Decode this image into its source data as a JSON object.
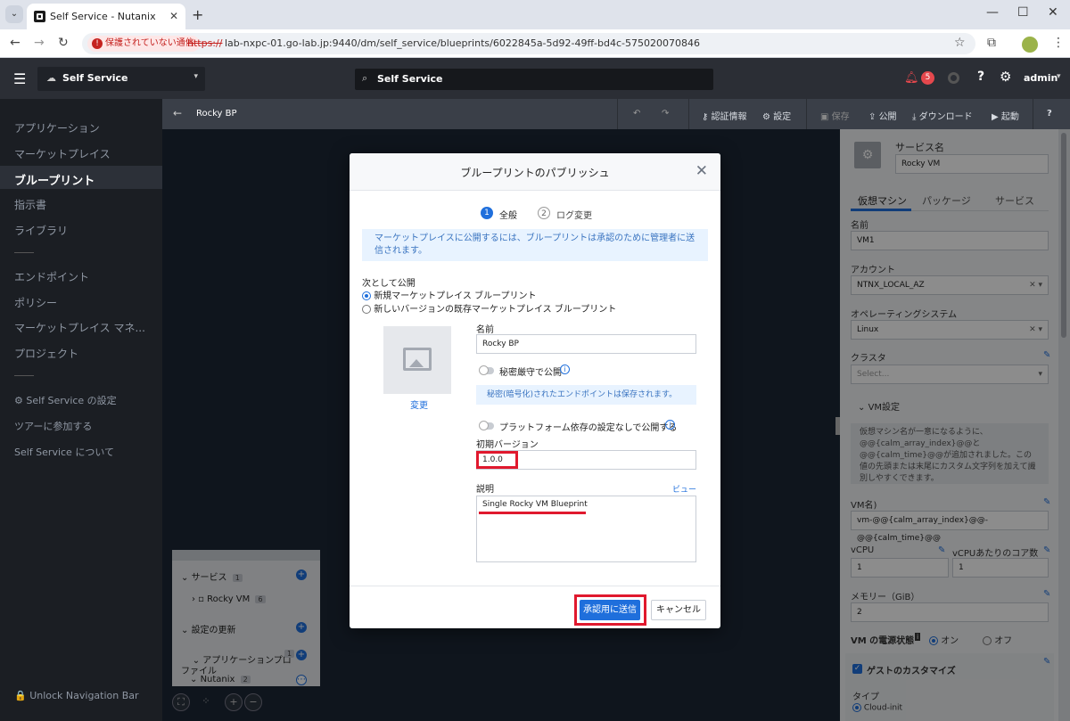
{
  "browser": {
    "tab_title": "Self Service - Nutanix",
    "new_tab": "+",
    "tab_close": "✕",
    "win_min": "—",
    "win_max": "☐",
    "win_close": "✕",
    "back": "←",
    "forward": "→",
    "reload": "↻",
    "not_secure": "保護されていない通信",
    "url_protocol": "https://",
    "url_rest": "lab-nxpc-01.go-lab.jp:9440/dm/self_service/blueprints/6022845a-5d92-49ff-bd4c-575020070846",
    "star": "☆",
    "menu": "⋮"
  },
  "header": {
    "app_name": "Self Service",
    "search_placeholder": "Self Service",
    "notification_count": "5",
    "help": "?",
    "user": "admin"
  },
  "sidebar": {
    "items": [
      {
        "label": "アプリケーション"
      },
      {
        "label": "マーケットプレイス"
      },
      {
        "label": "ブループリント"
      },
      {
        "label": "指示書"
      },
      {
        "label": "ライブラリ"
      },
      {
        "label": "エンドポイント"
      },
      {
        "label": "ポリシー"
      },
      {
        "label": "マーケットプレイス マネ..."
      },
      {
        "label": "プロジェクト"
      },
      {
        "label": "⚙ Self Service の設定"
      },
      {
        "label": "ツアーに参加する"
      },
      {
        "label": "Self Service について"
      }
    ],
    "unlock": "🔒 Unlock Navigation Bar"
  },
  "toolbar": {
    "blueprint_name": "Rocky BP",
    "credentials": "認証情報",
    "settings": "設定",
    "save": "保存",
    "publish": "公開",
    "download": "ダウンロード",
    "launch": "起動",
    "help": "?"
  },
  "mini_panel": {
    "services": "サービス",
    "services_count": "1",
    "rocky_vm": "Rocky VM",
    "rocky_vm_count": "6",
    "update_config": "設定の更新",
    "app_profile": "アプリケーションプロ\nファイル",
    "app_profile_count": "1",
    "nutanix": "Nutanix",
    "nutanix_count": "2"
  },
  "right_panel": {
    "service_name_label": "サービス名",
    "service_name": "Rocky VM",
    "tabs": [
      "仮想マシン",
      "パッケージ",
      "サービス"
    ],
    "name_label": "名前",
    "name_value": "VM1",
    "account_label": "アカウント",
    "account_value": "NTNX_LOCAL_AZ",
    "os_label": "オペレーティングシステム",
    "os_value": "Linux",
    "cluster_label": "クラスタ",
    "cluster_placeholder": "Select...",
    "vm_settings": "VM設定",
    "vm_note": "仮想マシン名が一意になるように、@@{calm_array_index}@@と@@{calm_time}@@が追加されました。この値の先頭または末尾にカスタム文字列を加えて識別しやすくできます。",
    "vm_name_label": "VM名)",
    "vm_name_value": "vm-@@{calm_array_index}@@-@@{calm_time}@@",
    "vcpu_label": "vCPU",
    "vcpu_value": "1",
    "cores_label": "vCPUあたりのコア数",
    "cores_value": "1",
    "memory_label": "メモリー（GiB）",
    "memory_value": "2",
    "power_label": "VM の電源状態",
    "power_on": "オン",
    "power_off": "オフ",
    "guest_custom": "ゲストのカスタマイズ",
    "type_label": "タイプ",
    "cloud_init": "Cloud-init"
  },
  "modal": {
    "title": "ブループリントのパブリッシュ",
    "step1_num": "1",
    "step1": "全般",
    "step2_num": "2",
    "step2": "ログ変更",
    "info": "マーケットプレイスに公開するには、ブループリントは承認のために管理者に送信されます。",
    "publish_as": "次として公開",
    "option_new": "新規マーケットプレイス ブループリント",
    "option_existing": "新しいバージョンの既存マーケットプレイス ブループリント",
    "change_image": "変更",
    "name_label": "名前",
    "name_value": "Rocky BP",
    "secret_toggle": "秘密厳守で公開",
    "secret_note": "秘密(暗号化)されたエンドポイントは保存されます。",
    "platform_toggle": "プラットフォーム依存の設定なしで公開する",
    "version_label": "初期バージョン",
    "version_value": "1.0.0",
    "desc_label": "説明",
    "preview": "ビュー",
    "desc_value": "Single Rocky VM Blueprint",
    "submit": "承認用に送信",
    "cancel": "キャンセル"
  }
}
